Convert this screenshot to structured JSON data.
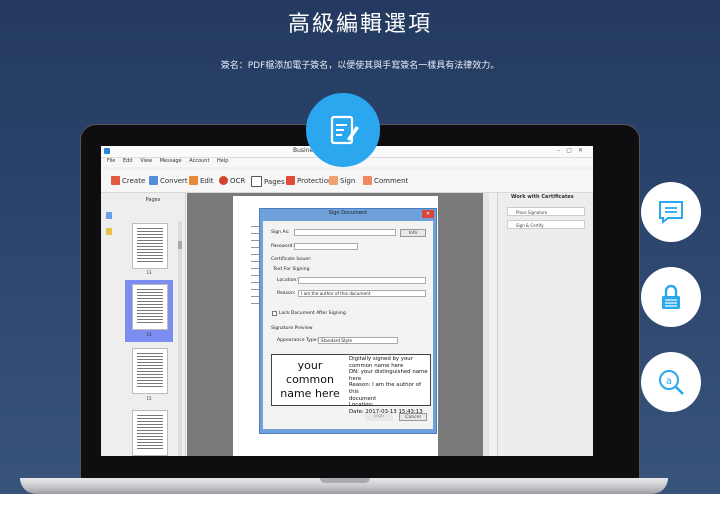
{
  "hero": {
    "title": "高級編輯選項",
    "subtitle": "簽名：PDF檔添加電子簽名，以便使其與手寫簽名一樣具有法律效力。"
  },
  "app": {
    "title": "Busine",
    "menu": [
      "File",
      "Edit",
      "View",
      "Message",
      "Account",
      "Help"
    ],
    "toolbar": {
      "create": "Create",
      "convert": "Convert",
      "edit": "Edit",
      "ocr": "OCR",
      "pages": "Pages",
      "protection": "Protection",
      "sign": "Sign",
      "comment": "Comment"
    },
    "pages_panel": {
      "header": "Pages",
      "thumb_labels": [
        "13",
        "14",
        "15"
      ]
    },
    "right_panel": {
      "header": "Work with Certificates",
      "items": [
        "Place Signature",
        "Sign & Certify"
      ]
    }
  },
  "dialog": {
    "title": "Sign Document",
    "sign_as_label": "Sign As:",
    "sign_as_value": "",
    "info_button": "Info",
    "password_label": "Password:",
    "certificate_issuer_label": "Certificate Issuer:",
    "text_for_signing_label": "Text For Signing",
    "location_label": "Location:",
    "location_value": "",
    "reason_label": "Reason:",
    "reason_value": "I am the author of this document",
    "lock_label": "Lock Document After Signing",
    "preview_label": "Signature Preview",
    "appearance_label": "Appearance Type:",
    "appearance_value": "Standard Style",
    "preview_big": "your common name here",
    "preview_lines": [
      "Digitally signed by your",
      "common name here",
      "DN: your distinguished name",
      "here",
      "Reason: I am the author of this",
      "document",
      "Location:",
      "Date: 2017-03-13 15:43:13"
    ],
    "sign_button": "Sign",
    "cancel_button": "Cancel"
  },
  "colors": {
    "accent": "#2aa7ee",
    "dialog_frame": "#6fa0d9",
    "close": "#d9473a"
  },
  "icons": [
    "pen-document-icon",
    "message-icon",
    "lock-icon",
    "search-document-icon"
  ]
}
